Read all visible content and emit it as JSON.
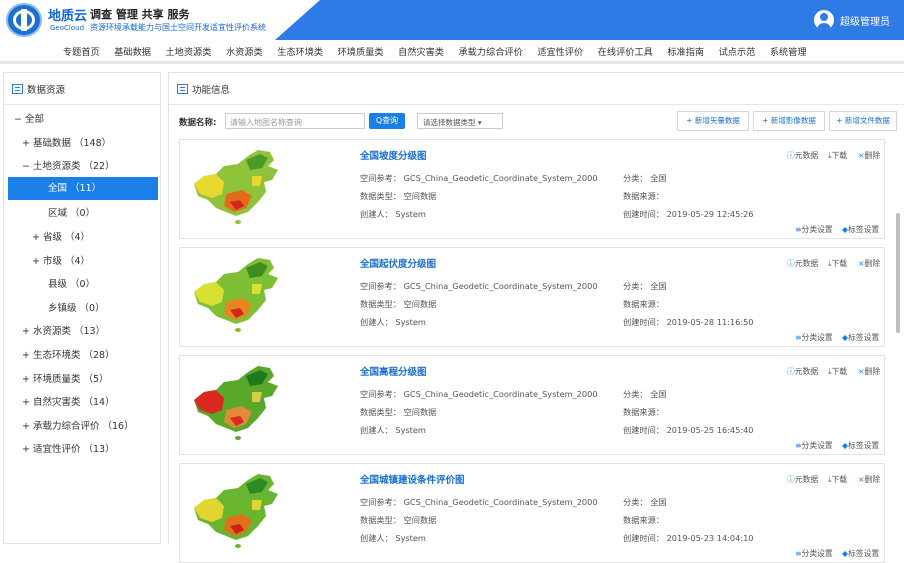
{
  "header": {
    "brand": "地质云",
    "brand_en": "GeoCloud",
    "slogan": "调查 管理 共享 服务",
    "slogan2": "资源环境承载能力与国土空间开发适宜性评价系统",
    "user": "超级管理员"
  },
  "nav": [
    "专题首页",
    "基础数据",
    "土地资源类",
    "水资源类",
    "生态环境类",
    "环境质量类",
    "自然灾害类",
    "承载力综合评价",
    "适宜性评价",
    "在线评价工具",
    "标准指南",
    "试点示范",
    "系统管理"
  ],
  "sidebar": {
    "title": "数据资源",
    "items": [
      {
        "label": "−  全部"
      },
      {
        "label": "+  基础数据 （148）"
      },
      {
        "label": "−  土地资源类 （22）"
      },
      {
        "label": "全国 （11）"
      },
      {
        "label": "区域 （0）"
      },
      {
        "label": "+  省级 （4）"
      },
      {
        "label": "+  市级 （4）"
      },
      {
        "label": "县级 （0）"
      },
      {
        "label": "乡镇级 （0）"
      },
      {
        "label": "+  水资源类 （13）"
      },
      {
        "label": "+  生态环境类 （28）"
      },
      {
        "label": "+  环境质量类 （5）"
      },
      {
        "label": "+  自然灾害类 （14）"
      },
      {
        "label": "+  承载力综合评价 （16）"
      },
      {
        "label": "+  适宜性评价 （13）"
      }
    ]
  },
  "main": {
    "title": "功能信息",
    "filter": {
      "label": "数据名称:",
      "placeholder": "请输入地图名称查询",
      "search": "Q查询",
      "select": "请选择数据类型 ▾",
      "add_vector": "+ 新增矢量数据",
      "add_image": "+ 新增影像数据",
      "add_file": "+ 新增文件数据"
    },
    "labels": {
      "ref": "空间参考：",
      "dtype": "数据类型：",
      "creator": "创建人：",
      "cat": "分类：",
      "source": "数据来源：",
      "ctime": "创建时间：",
      "meta": "元数据",
      "download": "下载",
      "delete": "删除",
      "classify": "分类设置",
      "tag": "标签设置"
    },
    "cards": [
      {
        "title": "全国坡度分级图",
        "ref": "GCS_China_Geodetic_Coordinate_System_2000",
        "dtype": "空间数据",
        "creator": "System",
        "cat": "全国",
        "source": "",
        "ctime": "2019-05-29 12:45:26"
      },
      {
        "title": "全国起伏度分级图",
        "ref": "GCS_China_Geodetic_Coordinate_System_2000",
        "dtype": "空间数据",
        "creator": "System",
        "cat": "全国",
        "source": "",
        "ctime": "2019-05-28 11:16:50"
      },
      {
        "title": "全国高程分级图",
        "ref": "GCS_China_Geodetic_Coordinate_System_2000",
        "dtype": "空间数据",
        "creator": "System",
        "cat": "全国",
        "source": "",
        "ctime": "2019-05-25 16:45:40"
      },
      {
        "title": "全国城镇建设条件评价图",
        "ref": "GCS_China_Geodetic_Coordinate_System_2000",
        "dtype": "空间数据",
        "creator": "System",
        "cat": "全国",
        "source": "",
        "ctime": "2019-05-23 14:04:10"
      }
    ]
  },
  "colors": {
    "accent": "#1a80e8",
    "header": "#2e7be6"
  }
}
